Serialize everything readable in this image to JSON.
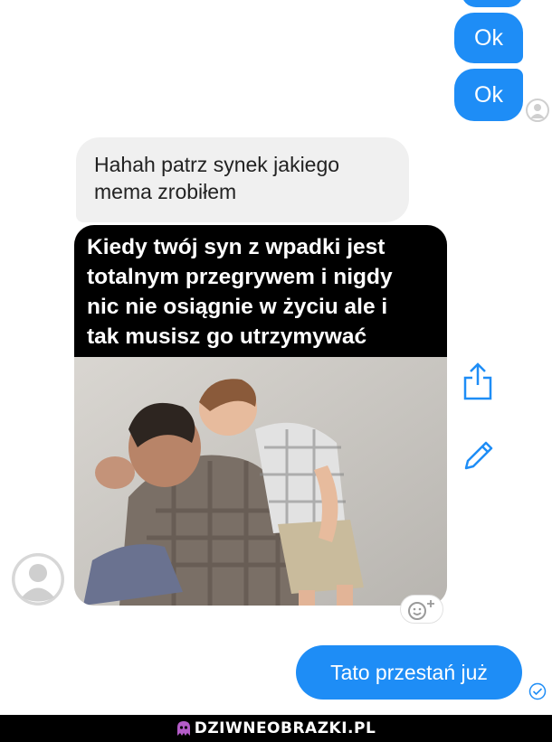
{
  "colors": {
    "outgoing_bubble": "#1e8df6",
    "incoming_bubble": "#f0f0f0",
    "footer": "#000000"
  },
  "messages": {
    "out_1": "Ok",
    "out_2": "Ok",
    "in_1": "Hahah patrz synek jakiego\nmema zrobiłem",
    "out_3": "Tato przestań już"
  },
  "meme": {
    "caption": "Kiedy twój syn z wpadki jest\ntotalnym przegrywem i nigdy\nnic nie osiągnie w życiu ale i\ntak musisz go utrzymywać"
  },
  "icons": {
    "share": "share-icon",
    "edit": "pencil-icon",
    "reaction": "add-reaction-icon",
    "delivered": "delivered-check-icon"
  },
  "footer": {
    "logo_text": "DZIWNEOBRAZKI.PL"
  }
}
